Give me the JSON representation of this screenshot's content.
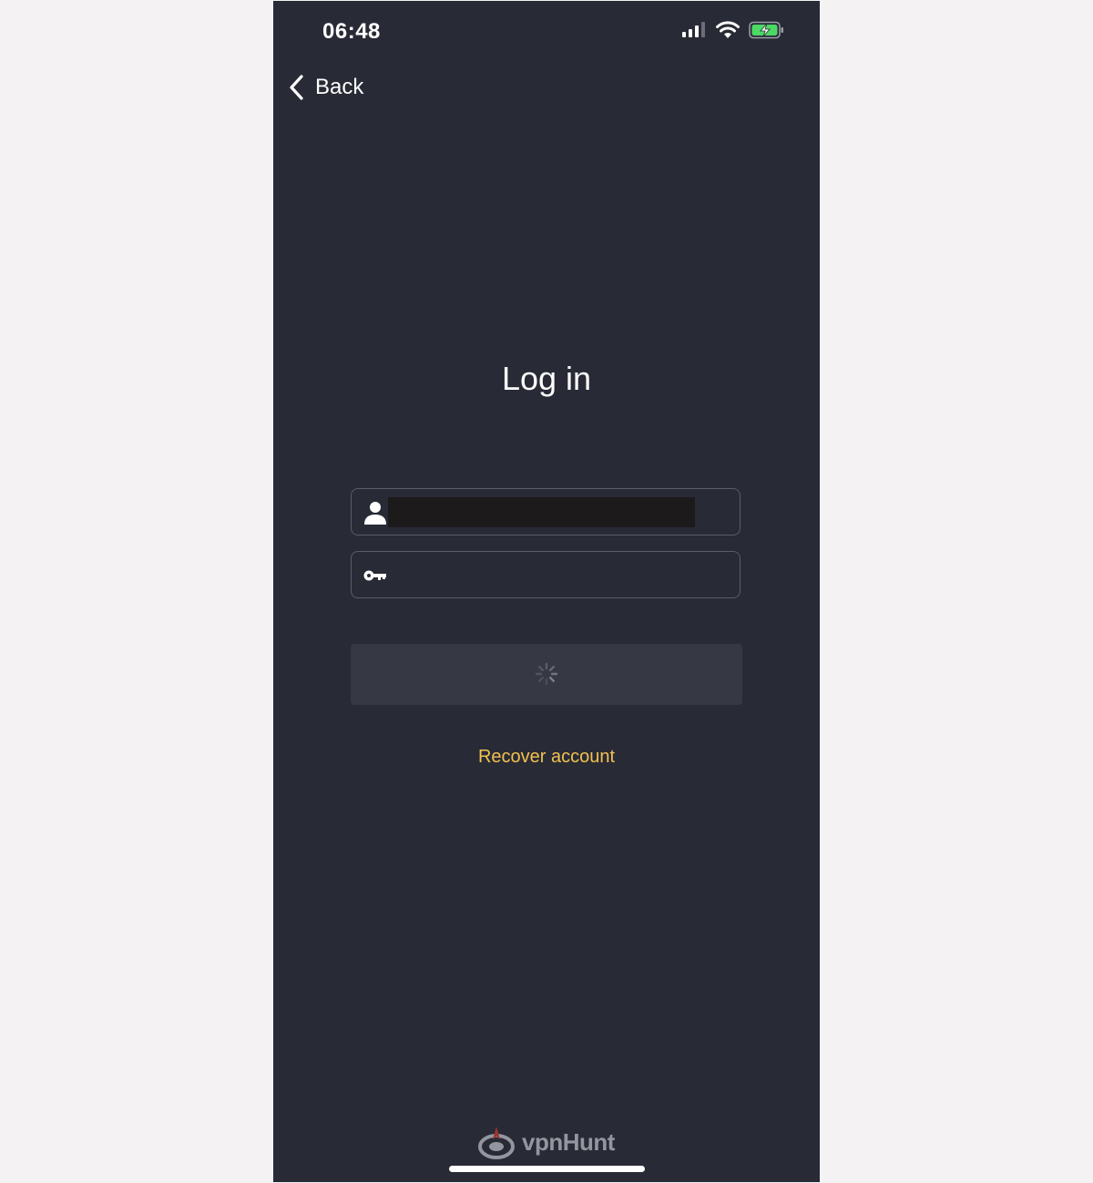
{
  "status_bar": {
    "time": "06:48",
    "icons": [
      "signal-icon",
      "wifi-icon",
      "battery-charging-icon"
    ],
    "battery_color": "#4cd964"
  },
  "nav": {
    "back_label": "Back",
    "back_icon": "chevron-left-icon"
  },
  "title": "Log in",
  "form": {
    "username": {
      "icon": "user-icon",
      "value": "",
      "redacted": true
    },
    "password": {
      "icon": "key-icon",
      "value": ""
    },
    "submit": {
      "state": "loading",
      "icon": "spinner-icon"
    }
  },
  "recover_label": "Recover account",
  "colors": {
    "background": "#282a36",
    "accent": "#f2c14e",
    "button": "#363843"
  }
}
